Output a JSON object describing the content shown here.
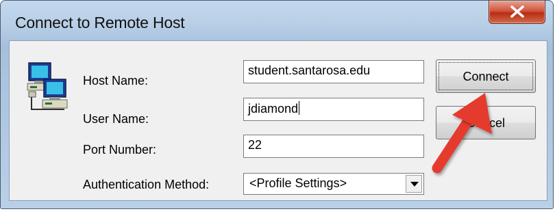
{
  "window": {
    "title": "Connect to Remote Host"
  },
  "form": {
    "host_name": {
      "label": "Host Name:",
      "value": "student.santarosa.edu"
    },
    "user_name": {
      "label": "User Name:",
      "value": "jdiamond"
    },
    "port_number": {
      "label": "Port Number:",
      "value": "22"
    },
    "authentication_method": {
      "label": "Authentication Method:",
      "selected": "<Profile Settings>"
    }
  },
  "buttons": {
    "connect": "Connect",
    "cancel": "Cancel"
  },
  "icons": {
    "window_icon": "networked-computers-icon",
    "close": "close-icon",
    "dropdown": "chevron-down-icon",
    "annotation": "red-pointer-arrow"
  },
  "colors": {
    "title_bar": "#b9d0e8",
    "close_button": "#c8452c",
    "annotation_arrow": "#e53a2f"
  }
}
